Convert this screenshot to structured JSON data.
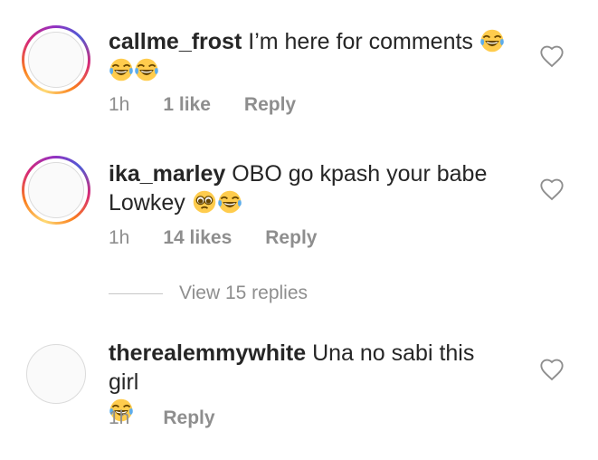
{
  "comments": [
    {
      "username": "callme_frost",
      "text": "I’m here for comments",
      "emojis_line1": [
        "laughing-tears"
      ],
      "emojis_line2": [
        "laughing-tears",
        "laughing-tears"
      ],
      "time": "1h",
      "likes": "1 like",
      "reply": "Reply",
      "story_ring": true
    },
    {
      "username": "ika_marley",
      "text_line1": "OBO go kpash your babe",
      "text_line2": "Lowkey",
      "emojis": [
        "pleading-face",
        "laughing-tears"
      ],
      "time": "1h",
      "likes": "14 likes",
      "reply": "Reply",
      "story_ring": true
    },
    {
      "username": "therealemmywhite",
      "text": "Una no sabi this girl",
      "emojis": [
        "laughing-tears"
      ],
      "time": "1h",
      "reply": "Reply",
      "story_ring": false
    }
  ],
  "view_replies": "View 15 replies",
  "colors": {
    "meta": "#8e8e8e",
    "text": "#262626",
    "accent_ring": "#d62976"
  }
}
